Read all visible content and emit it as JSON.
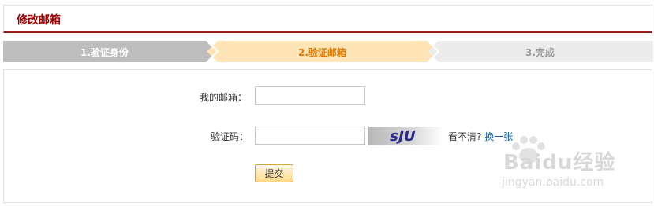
{
  "header": {
    "title": "修改邮箱"
  },
  "steps": [
    {
      "label": "1.验证身份",
      "state": "done",
      "bg": "#bdbdbd",
      "color": "#ffffff"
    },
    {
      "label": "2.验证邮箱",
      "state": "current",
      "bg": "#ffe4b5",
      "color": "#e07a00"
    },
    {
      "label": "3.完成",
      "state": "pending",
      "bg": "#ececec",
      "color": "#9a9a9a"
    }
  ],
  "form": {
    "email_label": "我的邮箱：",
    "email_value": "",
    "code_label": "验证码：",
    "code_value": "",
    "captcha_text": "sJU",
    "hint_text": "看不清?",
    "refresh_link": "换一张",
    "submit_label": "提交"
  },
  "watermark": {
    "main": "Baidu经验",
    "sub": "jingyan.baidu.com"
  }
}
